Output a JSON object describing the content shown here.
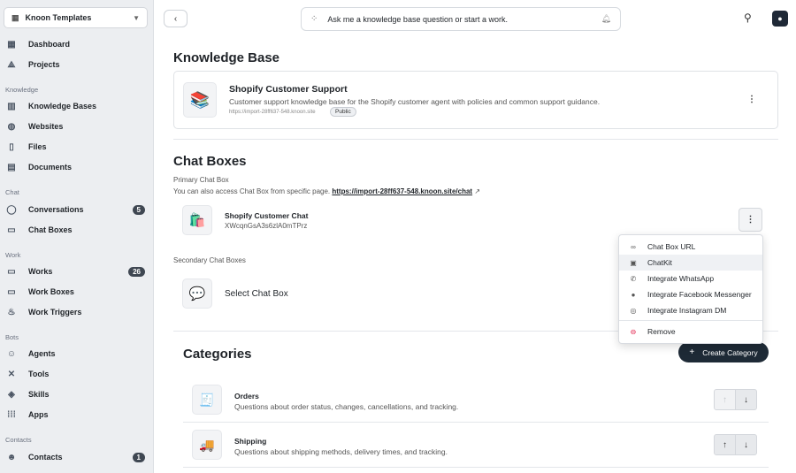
{
  "sidebar": {
    "workspace": "Knoon Templates",
    "top_items": [
      {
        "label": "Dashboard",
        "icon": "grid-icon"
      },
      {
        "label": "Projects",
        "icon": "shapes-icon"
      }
    ],
    "sections": {
      "knowledge": "Knowledge",
      "chat": "Chat",
      "work": "Work",
      "bots": "Bots",
      "contacts": "Contacts"
    },
    "knowledge_items": [
      {
        "label": "Knowledge Bases"
      },
      {
        "label": "Websites"
      },
      {
        "label": "Files"
      },
      {
        "label": "Documents"
      }
    ],
    "chat_items": [
      {
        "label": "Conversations",
        "badge": "5"
      },
      {
        "label": "Chat Boxes"
      }
    ],
    "work_items": [
      {
        "label": "Works",
        "badge": "26"
      },
      {
        "label": "Work Boxes"
      },
      {
        "label": "Work Triggers"
      }
    ],
    "bots_items": [
      {
        "label": "Agents"
      },
      {
        "label": "Tools"
      },
      {
        "label": "Skills"
      },
      {
        "label": "Apps"
      }
    ],
    "contacts_items": [
      {
        "label": "Contacts",
        "badge": "1"
      }
    ]
  },
  "topbar": {
    "ask_placeholder": "Ask me a knowledge base question or start a work."
  },
  "kb": {
    "heading": "Knowledge Base",
    "title": "Shopify Customer Support",
    "description": "Customer support knowledge base for the Shopify customer agent with policies and common support guidance.",
    "url": "https://import-28ff637-548.knoon.site",
    "badge": "Public"
  },
  "chat_boxes": {
    "heading": "Chat Boxes",
    "primary_label": "Primary Chat Box",
    "access_text": "You can also access Chat Box from specific page.",
    "access_link": "https://import-28ff637-548.knoon.site/chat",
    "primary": {
      "title": "Shopify Customer Chat",
      "id": "XWcqnGsA3s6zlA0mTPrz"
    },
    "secondary_label": "Secondary Chat Boxes",
    "secondary_select": "Select Chat Box"
  },
  "menu": {
    "items": [
      {
        "label": "Chat Box URL",
        "icon": "link-icon"
      },
      {
        "label": "ChatKit",
        "icon": "chatkit-icon"
      },
      {
        "label": "Integrate WhatsApp",
        "icon": "whatsapp-icon"
      },
      {
        "label": "Integrate Facebook Messenger",
        "icon": "messenger-icon"
      },
      {
        "label": "Integrate Instagram DM",
        "icon": "instagram-icon"
      },
      {
        "label": "Remove",
        "icon": "remove-icon"
      }
    ]
  },
  "categories": {
    "heading": "Categories",
    "create_label": "Create Category",
    "items": [
      {
        "title": "Orders",
        "description": "Questions about order status, changes, cancellations, and tracking."
      },
      {
        "title": "Shipping",
        "description": "Questions about shipping methods, delivery times, and tracking."
      }
    ]
  }
}
